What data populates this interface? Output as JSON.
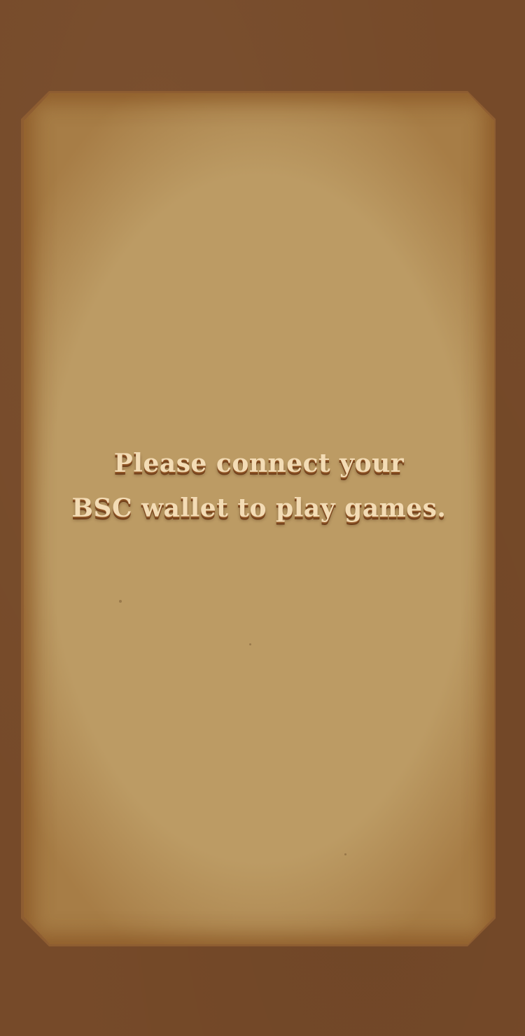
{
  "notice": {
    "line1": "Please connect your",
    "line2": "BSC wallet to play games."
  },
  "colors": {
    "background": "#764a29",
    "parchment": "#bc9b64",
    "text": "#f3dcb5"
  }
}
